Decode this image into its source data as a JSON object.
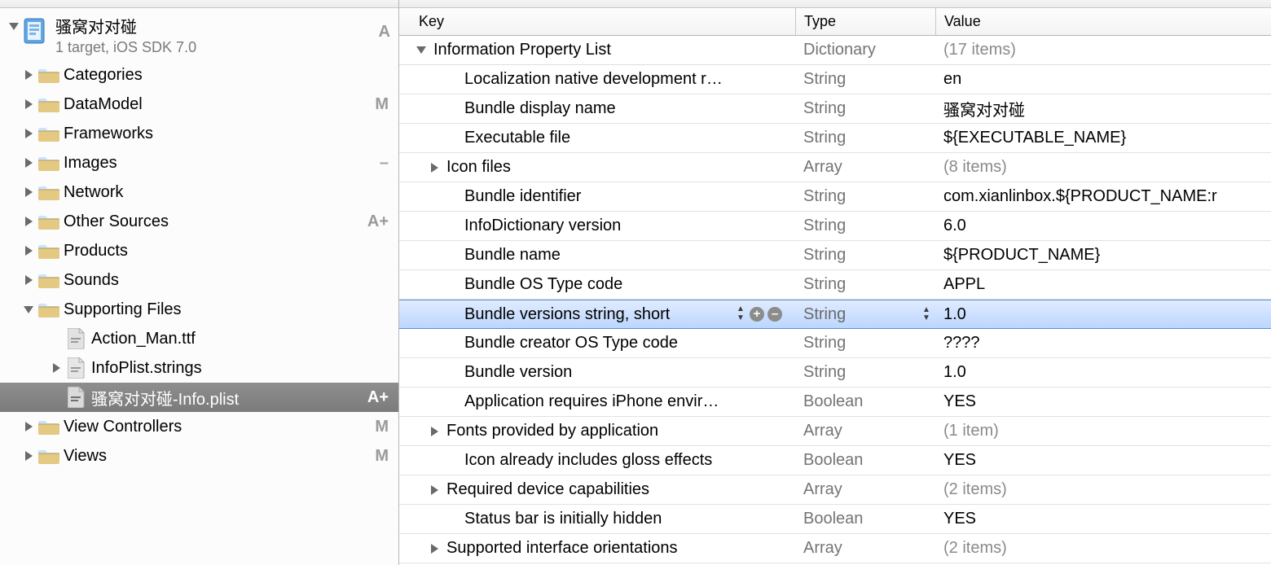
{
  "project": {
    "name": "骚窝对对碰",
    "subtitle": "1 target, iOS SDK 7.0",
    "status": "A"
  },
  "tree": [
    {
      "kind": "folder",
      "label": "Categories",
      "indent": 24,
      "disclosure": "right",
      "status": ""
    },
    {
      "kind": "folder",
      "label": "DataModel",
      "indent": 24,
      "disclosure": "right",
      "status": "M"
    },
    {
      "kind": "folder",
      "label": "Frameworks",
      "indent": 24,
      "disclosure": "right",
      "status": ""
    },
    {
      "kind": "folder",
      "label": "Images",
      "indent": 24,
      "disclosure": "right",
      "status": "–",
      "statusKind": "minus"
    },
    {
      "kind": "folder",
      "label": "Network",
      "indent": 24,
      "disclosure": "right",
      "status": ""
    },
    {
      "kind": "folder",
      "label": "Other Sources",
      "indent": 24,
      "disclosure": "right",
      "status": "A+"
    },
    {
      "kind": "folder",
      "label": "Products",
      "indent": 24,
      "disclosure": "right",
      "status": ""
    },
    {
      "kind": "folder",
      "label": "Sounds",
      "indent": 24,
      "disclosure": "right",
      "status": ""
    },
    {
      "kind": "folder",
      "label": "Supporting Files",
      "indent": 24,
      "disclosure": "down",
      "status": ""
    },
    {
      "kind": "file",
      "label": "Action_Man.ttf",
      "indent": 58,
      "disclosure": "none",
      "status": "",
      "fileicon": "ttf"
    },
    {
      "kind": "file",
      "label": "InfoPlist.strings",
      "indent": 58,
      "disclosure": "right",
      "status": "",
      "fileicon": "strings"
    },
    {
      "kind": "file",
      "label": "骚窝对对碰-Info.plist",
      "indent": 58,
      "disclosure": "none",
      "status": "A+",
      "fileicon": "plist",
      "selected": true
    },
    {
      "kind": "folder",
      "label": "View Controllers",
      "indent": 24,
      "disclosure": "right",
      "status": "M"
    },
    {
      "kind": "folder",
      "label": "Views",
      "indent": 24,
      "disclosure": "right",
      "status": "M"
    }
  ],
  "editor": {
    "columns": {
      "key": "Key",
      "type": "Type",
      "value": "Value"
    },
    "rows": [
      {
        "key": "Information Property List",
        "type": "Dictionary",
        "value": "(17 items)",
        "dim": true,
        "indent": 0,
        "disclosure": "down",
        "root": true
      },
      {
        "key": "Localization native development r…",
        "type": "String",
        "value": "en",
        "indent": 38,
        "disclosure": "none"
      },
      {
        "key": "Bundle display name",
        "type": "String",
        "value": "骚窝对对碰",
        "indent": 38,
        "disclosure": "none"
      },
      {
        "key": "Executable file",
        "type": "String",
        "value": "${EXECUTABLE_NAME}",
        "indent": 38,
        "disclosure": "none"
      },
      {
        "key": "Icon files",
        "type": "Array",
        "value": "(8 items)",
        "dim": true,
        "indent": 16,
        "disclosure": "right"
      },
      {
        "key": "Bundle identifier",
        "type": "String",
        "value": "com.xianlinbox.${PRODUCT_NAME:r",
        "indent": 38,
        "disclosure": "none"
      },
      {
        "key": "InfoDictionary version",
        "type": "String",
        "value": "6.0",
        "indent": 38,
        "disclosure": "none"
      },
      {
        "key": "Bundle name",
        "type": "String",
        "value": "${PRODUCT_NAME}",
        "indent": 38,
        "disclosure": "none"
      },
      {
        "key": "Bundle OS Type code",
        "type": "String",
        "value": "APPL",
        "indent": 38,
        "disclosure": "none"
      },
      {
        "key": "Bundle versions string, short",
        "type": "String",
        "value": "1.0",
        "indent": 38,
        "disclosure": "none",
        "selected": true,
        "controls": true
      },
      {
        "key": "Bundle creator OS Type code",
        "type": "String",
        "value": "????",
        "indent": 38,
        "disclosure": "none"
      },
      {
        "key": "Bundle version",
        "type": "String",
        "value": "1.0",
        "indent": 38,
        "disclosure": "none"
      },
      {
        "key": "Application requires iPhone envir…",
        "type": "Boolean",
        "value": "YES",
        "indent": 38,
        "disclosure": "none"
      },
      {
        "key": "Fonts provided by application",
        "type": "Array",
        "value": "(1 item)",
        "dim": true,
        "indent": 16,
        "disclosure": "right"
      },
      {
        "key": "Icon already includes gloss effects",
        "type": "Boolean",
        "value": "YES",
        "indent": 38,
        "disclosure": "none"
      },
      {
        "key": "Required device capabilities",
        "type": "Array",
        "value": "(2 items)",
        "dim": true,
        "indent": 16,
        "disclosure": "right"
      },
      {
        "key": "Status bar is initially hidden",
        "type": "Boolean",
        "value": "YES",
        "indent": 38,
        "disclosure": "none"
      },
      {
        "key": "Supported interface orientations",
        "type": "Array",
        "value": "(2 items)",
        "dim": true,
        "indent": 16,
        "disclosure": "right"
      }
    ]
  }
}
